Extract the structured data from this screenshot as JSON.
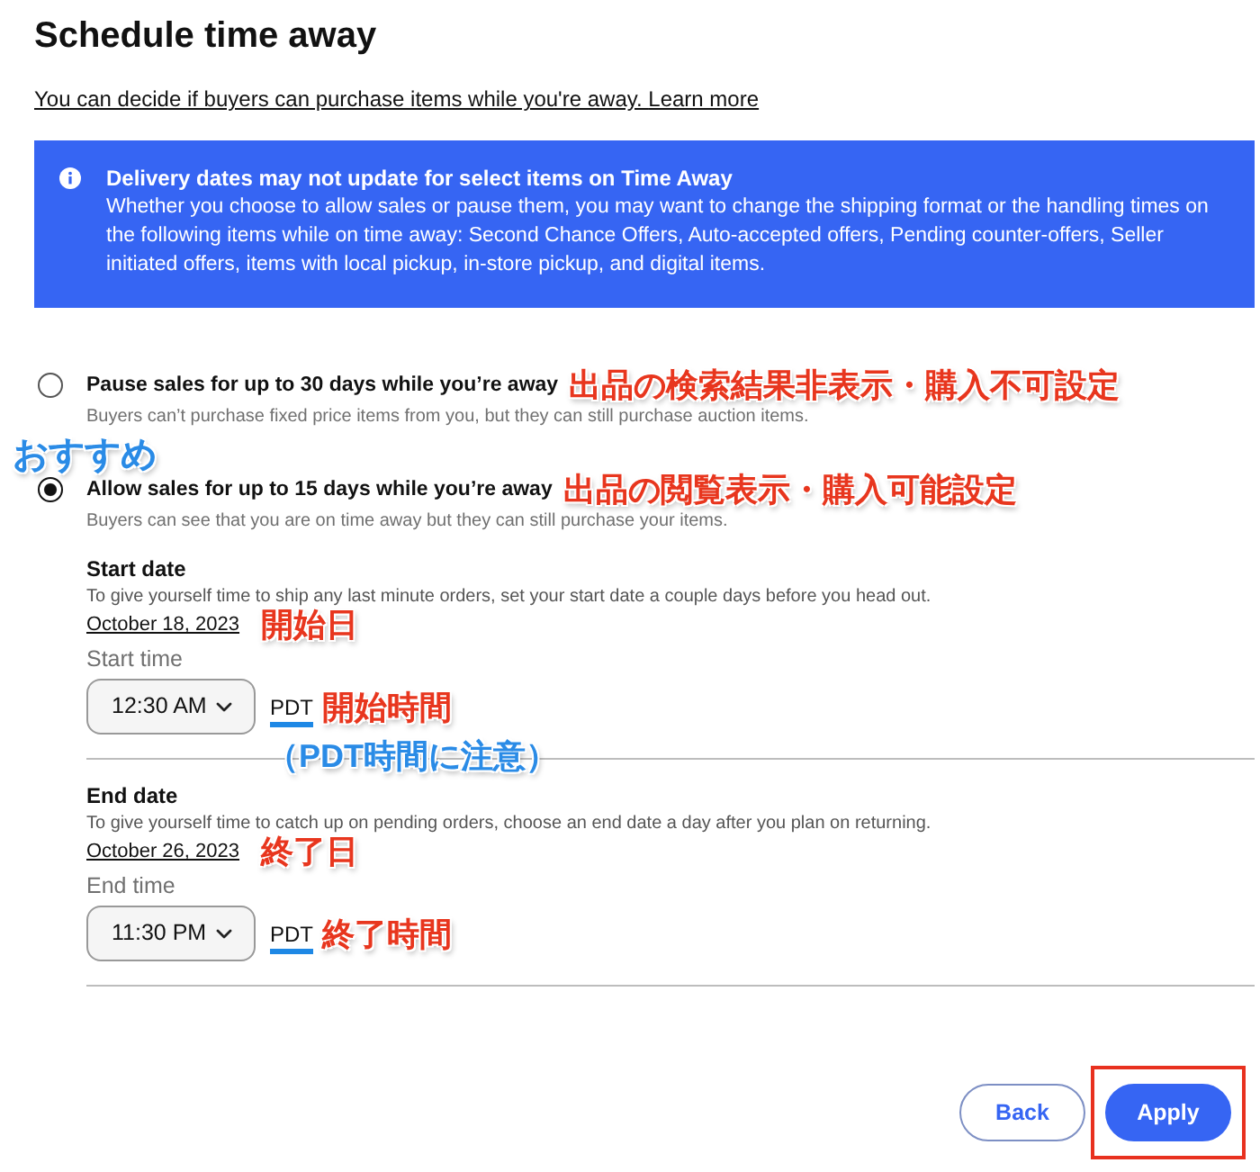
{
  "header": {
    "title": "Schedule time away",
    "intro": "You can decide if buyers can purchase items while you're away.",
    "learn_more": "Learn more"
  },
  "notice": {
    "title": "Delivery dates may not update for select items on Time Away",
    "body": "Whether you choose to allow sales or pause them, you may want to change the shipping format or the handling times on the following items while on time away: Second Chance Offers, Auto-accepted offers, Pending counter-offers, Seller initiated offers, items with local pickup, in-store pickup, and digital items."
  },
  "options": [
    {
      "label": "Pause sales for up to 30 days while you’re away",
      "description": "Buyers can’t purchase fixed price items from you, but they can still purchase auction items.",
      "selected": false,
      "note": "出品の検索結果非表示・購入不可設定"
    },
    {
      "label": "Allow sales for up to 15 days while you’re away",
      "description": "Buyers can see that you are on time away but they can still purchase your items.",
      "selected": true,
      "note": "出品の閲覧表示・購入可能設定",
      "recommend_note": "おすすめ"
    }
  ],
  "schedule": [
    {
      "heading": "Start date",
      "help": "To give yourself time to ship any last minute orders, set your start date a couple days before you head out.",
      "date": "October 18, 2023",
      "date_note": "開始日",
      "time_label": "Start time",
      "time": "12:30 AM",
      "time_zone": "PDT",
      "time_zone_marked": true,
      "time_note": "開始時間",
      "time_zone_note": "（PDT時間に注意）"
    },
    {
      "heading": "End date",
      "help": "To give yourself time to catch up on pending orders, choose an end date a day after you plan on returning.",
      "date": "October 26, 2023",
      "date_note": "終了日",
      "time_label": "End time",
      "time": "11:30 PM",
      "time_zone": "PDT",
      "time_zone_marked": true,
      "time_note": "終了時間"
    }
  ],
  "buttons": [
    {
      "label": "Back",
      "kind": "secondary",
      "highlighted": false
    },
    {
      "label": "Apply",
      "kind": "primary",
      "highlighted": true
    }
  ]
}
